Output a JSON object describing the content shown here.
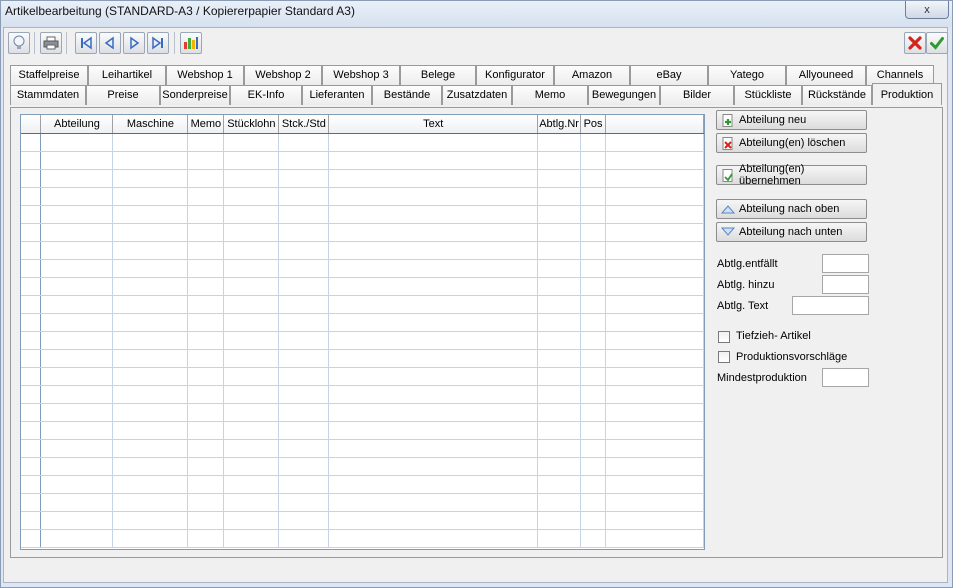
{
  "window": {
    "title": "Artikelbearbeitung (STANDARD-A3 / Kopiererpapier Standard A3)",
    "close_label": "x"
  },
  "toolbar": {
    "buttons": [
      {
        "name": "lightbulb-icon"
      },
      {
        "name": "printer-icon"
      },
      {
        "name": "first-record-icon"
      },
      {
        "name": "previous-record-icon"
      },
      {
        "name": "next-record-icon"
      },
      {
        "name": "last-record-icon"
      },
      {
        "name": "bar-chart-icon"
      }
    ],
    "cancel_icon": "red-x-icon",
    "confirm_icon": "green-check-icon"
  },
  "tabs": {
    "row1": [
      "Staffelpreise",
      "Leihartikel",
      "Webshop 1",
      "Webshop 2",
      "Webshop 3",
      "Belege",
      "Konfigurator",
      "Amazon",
      "eBay",
      "Yatego",
      "Allyouneed",
      "Channels"
    ],
    "row2": [
      "Stammdaten",
      "Preise",
      "Sonderpreise",
      "EK-Info",
      "Lieferanten",
      "Bestände",
      "Zusatzdaten",
      "Memo",
      "Bewegungen",
      "Bilder",
      "Stückliste",
      "Rückstände",
      "Produktion"
    ],
    "active": "Produktion"
  },
  "grid": {
    "columns": [
      "",
      "Abteilung",
      "Maschine",
      "Memo",
      "Stücklohn",
      "Stck./Std",
      "Text",
      "Abtlg.Nr",
      "Pos",
      ""
    ],
    "rows": []
  },
  "actions": {
    "add_department": "Abteilung neu",
    "delete_departments": "Abteilung(en) löschen",
    "apply_departments": "Abteilung(en) übernehmen",
    "move_up": "Abteilung nach oben",
    "move_down": "Abteilung nach unten"
  },
  "fields": {
    "abtlg_entfaellt": {
      "label": "Abtlg.entfällt",
      "value": ""
    },
    "abtlg_hinzu": {
      "label": "Abtlg. hinzu",
      "value": ""
    },
    "abtlg_text": {
      "label": "Abtlg. Text",
      "value": ""
    },
    "tiefzieh": {
      "label": "Tiefzieh- Artikel",
      "checked": false
    },
    "produktionsvorschlaege": {
      "label": "Produktionsvorschläge",
      "checked": false
    },
    "mindestproduktion": {
      "label": "Mindestproduktion",
      "value": ""
    }
  }
}
